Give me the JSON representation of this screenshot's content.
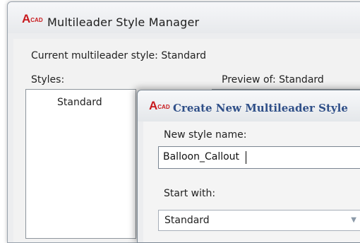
{
  "main_window": {
    "title": "Multileader Style Manager",
    "current_label": "Current multileader style: Standard",
    "styles_label": "Styles:",
    "preview_label": "Preview of: Standard",
    "styles": [
      "Standard"
    ]
  },
  "dialog": {
    "title": "Create New Multileader Style",
    "name_label": "New style name:",
    "name_value": "Balloon_Callout",
    "start_label": "Start with:",
    "start_value": "Standard"
  },
  "icons": {
    "app_icon_big": "A",
    "app_icon_small": "CAD",
    "dropdown_icon": "chevron-down-icon"
  },
  "colors": {
    "app_icon": "#c8191d",
    "dialog_title": "#2f4f88"
  }
}
